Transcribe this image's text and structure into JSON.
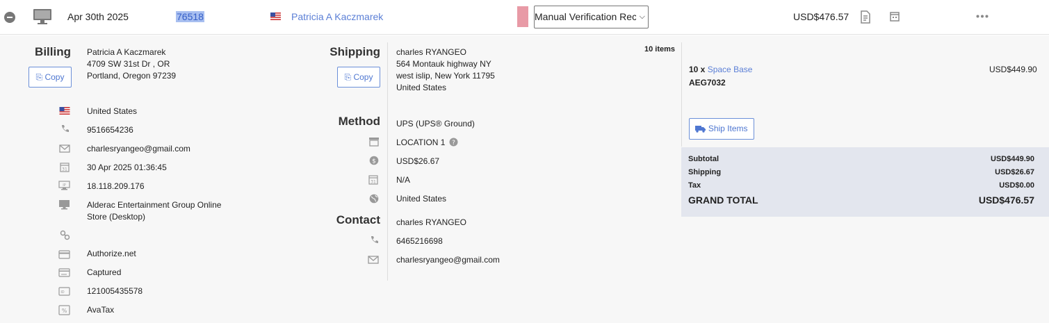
{
  "order": {
    "date": "Apr 30th 2025",
    "id": "76518",
    "customer": "Patricia A Kaczmarek",
    "status": "Manual Verification Rec",
    "total": "USD$476.57",
    "status_color": "#e89aa6"
  },
  "billing": {
    "title": "Billing",
    "copy_label": "Copy",
    "address": [
      "Patricia A Kaczmarek",
      "4709 SW 31st Dr , OR",
      "Portland, Oregon 97239"
    ],
    "country": "United States",
    "phone": "9516654236",
    "email": "charlesryangeo@gmail.com",
    "datetime": "30 Apr 2025 01:36:45",
    "ip": "18.118.209.176",
    "store_line1": "Alderac Entertainment Group Online",
    "store_line2": "Store (Desktop)",
    "gateway": "Authorize.net",
    "payment_status": "Captured",
    "transaction_id": "121005435578",
    "tax_provider": "AvaTax"
  },
  "shipping": {
    "title": "Shipping",
    "copy_label": "Copy",
    "address": [
      "charles RYANGEO",
      "564 Montauk highway NY",
      "west islip, New York 11795",
      "United States"
    ],
    "item_count": "10 items"
  },
  "method": {
    "title": "Method",
    "service": "UPS (UPS® Ground)",
    "location": "LOCATION 1",
    "cost": "USD$26.67",
    "date": "N/A",
    "region": "United States"
  },
  "contact": {
    "title": "Contact",
    "name": "charles RYANGEO",
    "phone": "6465216698",
    "email": "charlesryangeo@gmail.com"
  },
  "items": [
    {
      "qty": "10 x",
      "name": "Space Base",
      "sku": "AEG7032",
      "price": "USD$449.90"
    }
  ],
  "ship_items_label": "Ship Items",
  "summary": {
    "subtotal_label": "Subtotal",
    "subtotal": "USD$449.90",
    "shipping_label": "Shipping",
    "shipping": "USD$26.67",
    "tax_label": "Tax",
    "tax": "USD$0.00",
    "grand_label": "GRAND TOTAL",
    "grand": "USD$476.57"
  }
}
